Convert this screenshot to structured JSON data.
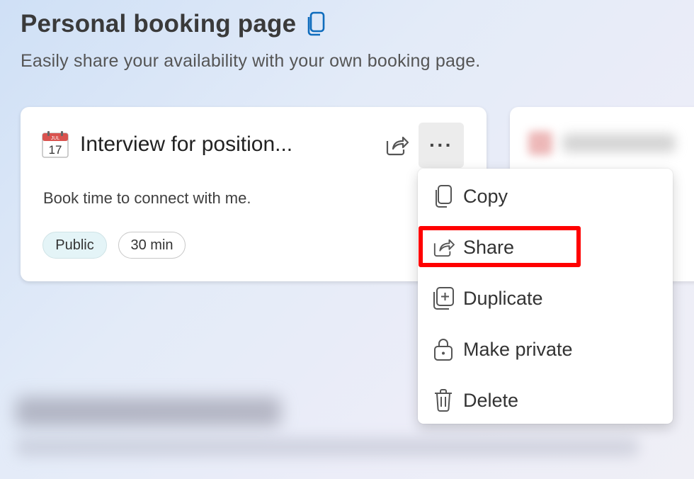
{
  "header": {
    "title": "Personal booking page",
    "subtitle": "Easily share your availability with your own booking page."
  },
  "card": {
    "calendar_month": "JUL",
    "calendar_day": "17",
    "title": "Interview for position...",
    "description": "Book time to connect with me.",
    "badge_public": "Public",
    "badge_duration": "30 min",
    "more_label": "···"
  },
  "menu": {
    "items": [
      {
        "label": "Copy",
        "icon": "copy-icon"
      },
      {
        "label": "Share",
        "icon": "share-icon"
      },
      {
        "label": "Duplicate",
        "icon": "duplicate-icon"
      },
      {
        "label": "Make private",
        "icon": "lock-icon"
      },
      {
        "label": "Delete",
        "icon": "trash-icon"
      }
    ],
    "highlighted": "Share"
  },
  "colors": {
    "accent": "#0f6cbd",
    "highlight": "#ff0000",
    "public_badge_bg": "#e4f4f7"
  }
}
